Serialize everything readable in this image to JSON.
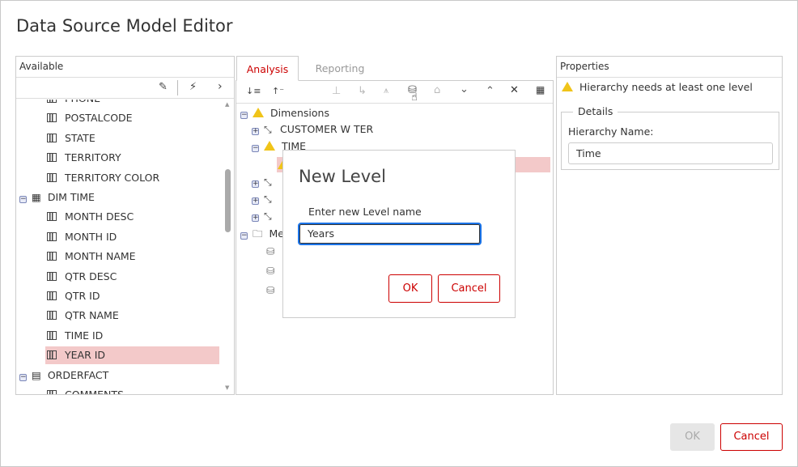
{
  "window": {
    "title": "Data Source Model Editor"
  },
  "available": {
    "header": "Available",
    "items": [
      {
        "label": "PHONE",
        "type": "column"
      },
      {
        "label": "POSTALCODE",
        "type": "column"
      },
      {
        "label": "STATE",
        "type": "column"
      },
      {
        "label": "TERRITORY",
        "type": "column"
      },
      {
        "label": "TERRITORY COLOR",
        "type": "column"
      },
      {
        "label": "DIM TIME",
        "type": "table"
      },
      {
        "label": "MONTH DESC",
        "type": "column"
      },
      {
        "label": "MONTH ID",
        "type": "column"
      },
      {
        "label": "MONTH NAME",
        "type": "column"
      },
      {
        "label": "QTR DESC",
        "type": "column"
      },
      {
        "label": "QTR ID",
        "type": "column"
      },
      {
        "label": "QTR NAME",
        "type": "column"
      },
      {
        "label": "TIME ID",
        "type": "column"
      },
      {
        "label": "YEAR ID",
        "type": "column",
        "selected": true
      },
      {
        "label": "ORDERFACT",
        "type": "fact"
      },
      {
        "label": "COMMENTS",
        "type": "column"
      }
    ]
  },
  "model": {
    "tabs": [
      {
        "label": "Analysis",
        "active": true
      },
      {
        "label": "Reporting"
      }
    ],
    "tree": {
      "dimensions": "Dimensions",
      "customer": "CUSTOMER W TER",
      "time": "TIME",
      "measures_prefix": "Me"
    }
  },
  "properties": {
    "header": "Properties",
    "warning": "Hierarchy needs at least one level",
    "details_legend": "Details",
    "name_label": "Hierarchy Name:",
    "name_value": "Time"
  },
  "dialog": {
    "title": "New Level",
    "label": "Enter new Level name",
    "value": "Years",
    "ok": "OK",
    "cancel": "Cancel"
  },
  "footer": {
    "ok": "OK",
    "cancel": "Cancel"
  },
  "colors": {
    "accent": "#cc0000",
    "selected": "#f3c9c9",
    "focus": "#1a73e8"
  }
}
